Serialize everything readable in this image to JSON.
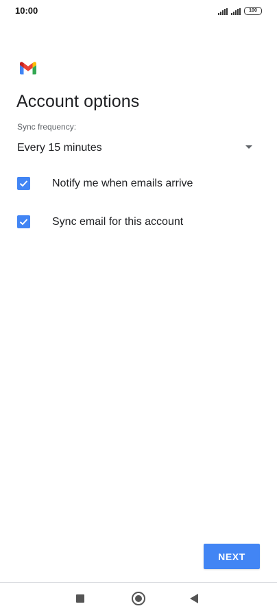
{
  "status_bar": {
    "time": "10:00",
    "battery_level": "100",
    "icons": [
      "signal-icon",
      "signal-icon",
      "battery-icon"
    ]
  },
  "app": {
    "logo_icon": "gmail-logo-icon",
    "brand_colors": {
      "blue": "#4285f4",
      "red": "#ea4335",
      "yellow": "#fbbc04",
      "green": "#34a853"
    }
  },
  "page": {
    "title": "Account options"
  },
  "sync": {
    "label": "Sync frequency:",
    "selected_value": "Every 15 minutes"
  },
  "options": [
    {
      "label": "Notify me when emails arrive",
      "checked": true
    },
    {
      "label": "Sync email for this account",
      "checked": true
    }
  ],
  "actions": {
    "next_label": "NEXT"
  },
  "accent_color": "#4285f4",
  "nav_bar": {
    "icons": [
      "recents-icon",
      "home-icon",
      "back-icon"
    ]
  }
}
